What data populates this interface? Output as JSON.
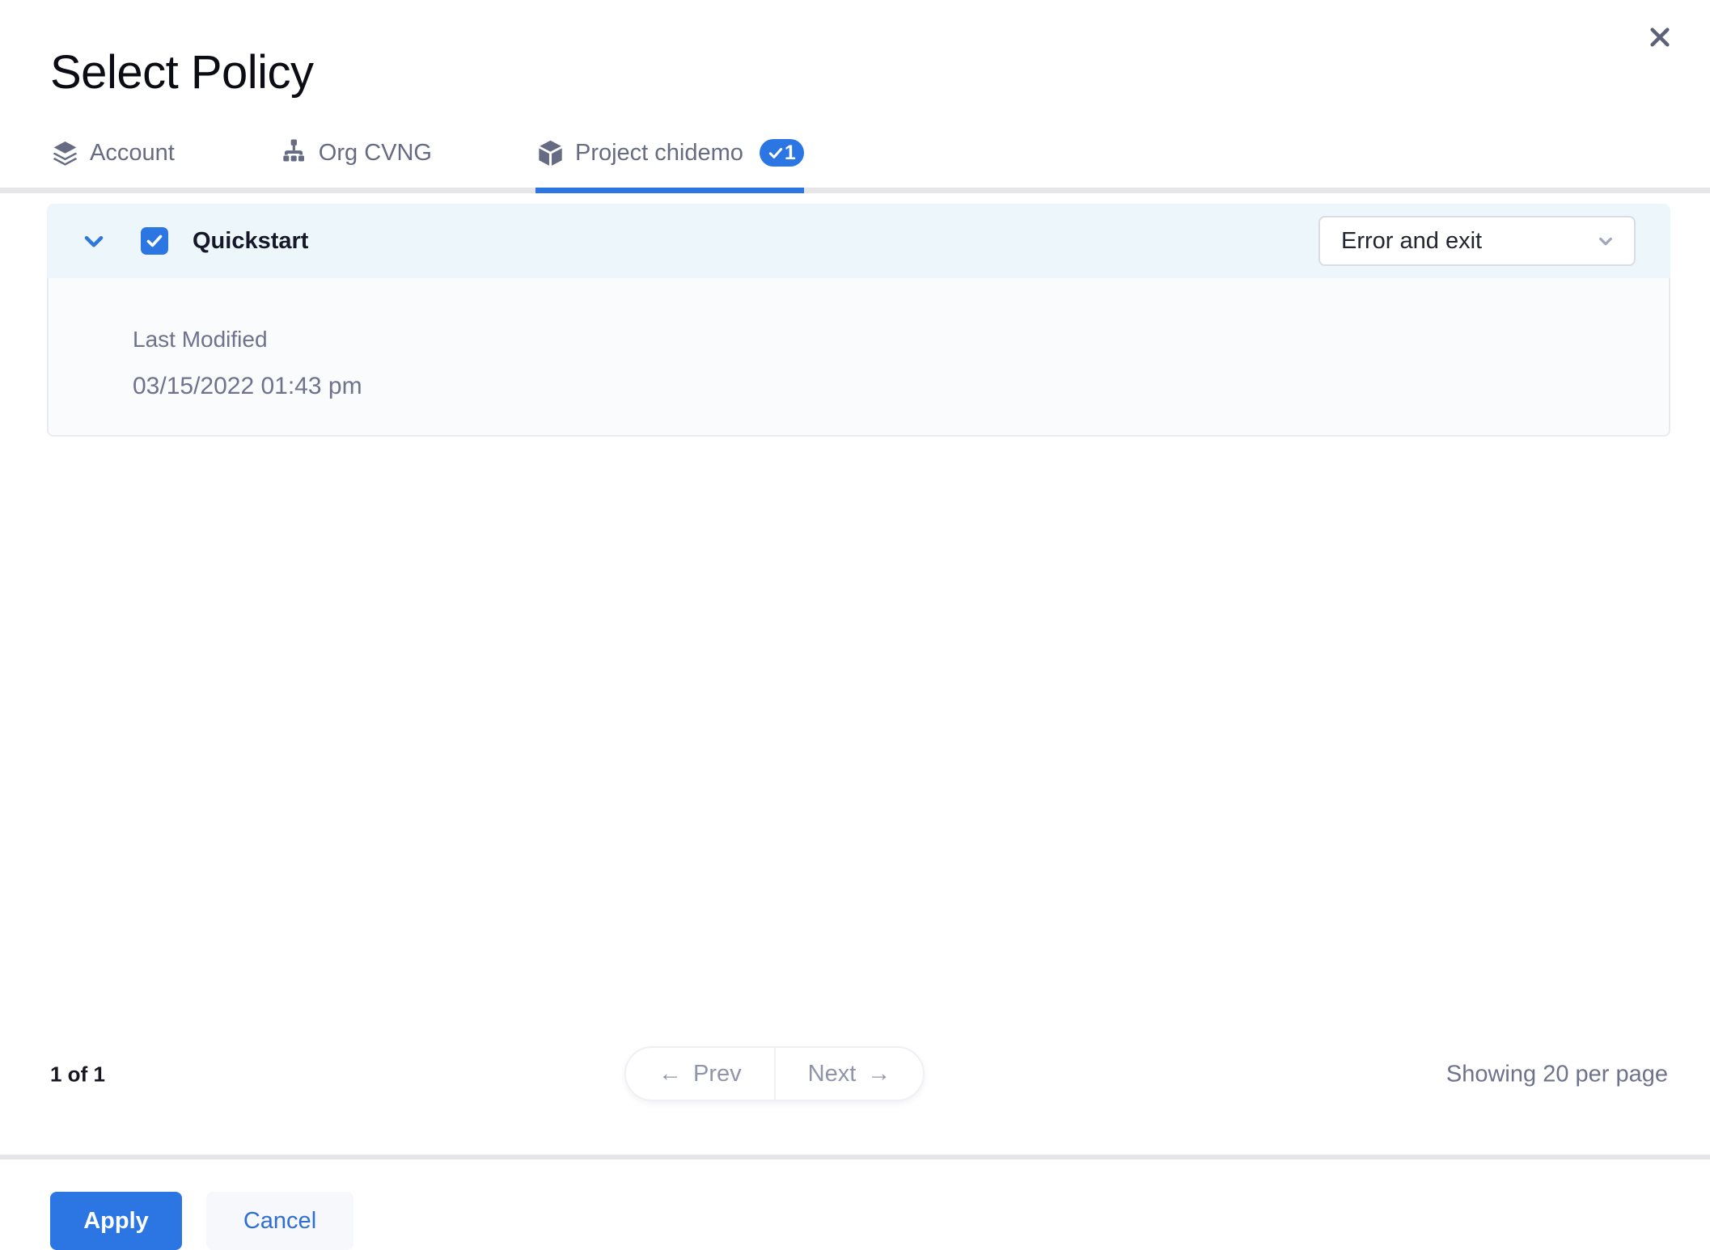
{
  "modal": {
    "title": "Select Policy"
  },
  "tabs": [
    {
      "id": "account",
      "label": "Account",
      "icon": "layers-icon",
      "active": false
    },
    {
      "id": "org",
      "label": "Org CVNG",
      "icon": "org-chart-icon",
      "active": false
    },
    {
      "id": "project",
      "label": "Project chidemo",
      "icon": "cube-icon",
      "active": true,
      "badge": "1",
      "badge_icon": "check-icon"
    }
  ],
  "policy_list": {
    "rows": [
      {
        "name": "Quickstart",
        "checked": true,
        "expanded": true,
        "action_select": {
          "selected": "Error and exit"
        },
        "details": {
          "label": "Last Modified",
          "value": "03/15/2022 01:43 pm"
        }
      }
    ]
  },
  "pagination": {
    "page_info": "1 of 1",
    "prev_arrow": "←",
    "prev_label": "Prev",
    "next_label": "Next",
    "next_arrow": "→",
    "per_page": "Showing 20 per page"
  },
  "footer": {
    "apply_label": "Apply",
    "cancel_label": "Cancel"
  },
  "colors": {
    "primary": "#2b76e3",
    "slate": "#666b83",
    "text-dark": "#101220",
    "muted": "#6e728c",
    "divider": "#e6e6e9",
    "header-bg": "#edf7fb",
    "body-bg": "#fafbfc",
    "card-border": "#e9ebf0",
    "select-border": "#d9dbe6",
    "cancel-bg": "#f7f8fb",
    "link": "#2f6ed2",
    "pager-text": "#9094ab",
    "pager-border": "#eff0f4"
  }
}
